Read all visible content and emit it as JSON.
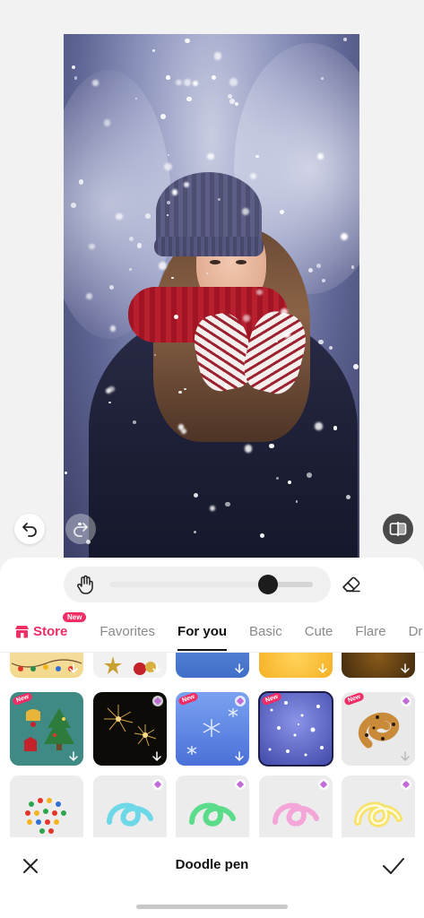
{
  "canvas": {
    "undo_icon": "undo-icon",
    "redo_icon": "redo-icon",
    "compare_icon": "compare-icon"
  },
  "brush": {
    "size_fraction": 0.78,
    "left_icon": "hand-gesture-icon",
    "right_icon": "eraser-icon"
  },
  "tabs": {
    "store_label": "Store",
    "store_badge": "New",
    "items": [
      "Favorites",
      "For you",
      "Basic",
      "Cute",
      "Flare",
      "Dr"
    ],
    "active": "For you"
  },
  "tile_badge": "New",
  "accent_color": "#f02d65",
  "bottom": {
    "title": "Doodle pen",
    "close_icon": "close-icon",
    "confirm_icon": "checkmark-icon"
  }
}
